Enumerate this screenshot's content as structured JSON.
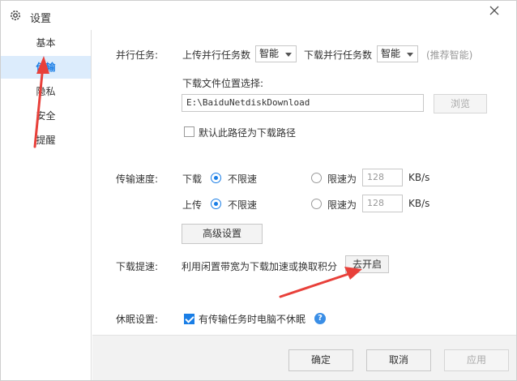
{
  "window": {
    "title": "设置"
  },
  "sidebar": {
    "items": [
      {
        "label": "基本"
      },
      {
        "label": "传输"
      },
      {
        "label": "隐私"
      },
      {
        "label": "安全"
      },
      {
        "label": "提醒"
      }
    ]
  },
  "parallel": {
    "label": "并行任务:",
    "upload_label": "上传并行任务数",
    "upload_value": "智能",
    "download_label": "下载并行任务数",
    "download_value": "智能",
    "hint": "(推荐智能)"
  },
  "location": {
    "label": "下载文件位置选择:",
    "path": "E:\\BaiduNetdiskDownload",
    "browse_label": "浏览",
    "default_checkbox_label": "默认此路径为下载路径"
  },
  "speed": {
    "label": "传输速度:",
    "download_label": "下载",
    "upload_label": "上传",
    "unlimited_label": "不限速",
    "limit_label": "限速为",
    "download_limit_value": "128",
    "upload_limit_value": "128",
    "unit": "KB/s",
    "advanced_label": "高级设置"
  },
  "boost": {
    "label": "下载提速:",
    "text": "利用闲置带宽为下载加速或换取积分",
    "button_label": "去开启"
  },
  "sleep": {
    "label": "休眠设置:",
    "checkbox_label": "有传输任务时电脑不休眠",
    "help_glyph": "?"
  },
  "footer": {
    "ok_label": "确定",
    "cancel_label": "取消",
    "apply_label": "应用"
  },
  "colors": {
    "accent": "#1a7ee6",
    "sidebar_active_bg": "#dcecfc",
    "annotation_arrow": "#e8403a"
  }
}
